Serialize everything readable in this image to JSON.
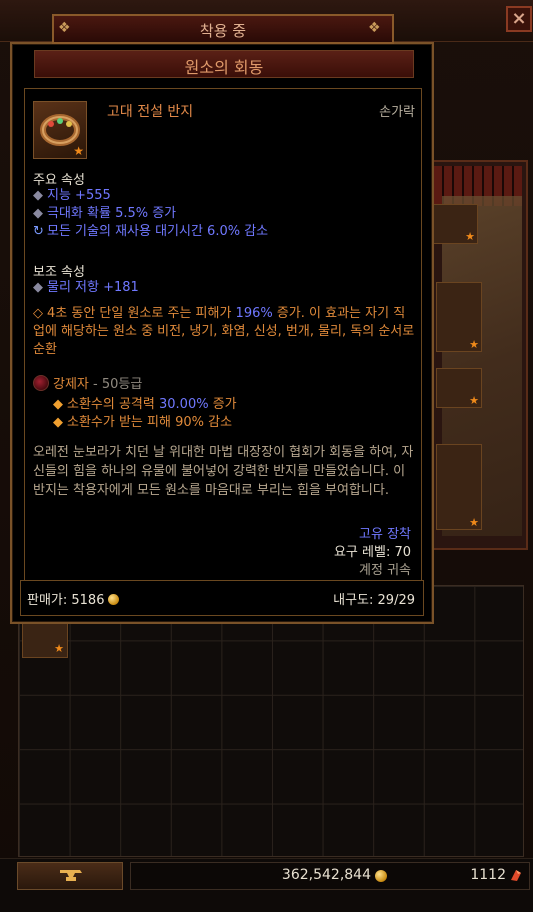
{
  "window": {
    "close_label": "×"
  },
  "tooltip": {
    "header": "착용 중",
    "item_name": "원소의 회동",
    "item_type": "고대 전설 반지",
    "slot": "손가락",
    "primary": {
      "title": "주요 속성",
      "affixes": [
        "지능 +555",
        "극대화 확률 5.5% 증가",
        "모든 기술의 재사용 대기시간 6.0% 감소"
      ]
    },
    "secondary": {
      "title": "보조 속성",
      "affixes": [
        "물리 저항 +181"
      ],
      "legendary_prefix": "4초 동안 단일 원소로 주는 피해가 ",
      "legendary_value": "196%",
      "legendary_suffix": " 증가. 이 효과는 자기 직업에 해당하는 원소 중 비전, 냉기, 화염, 신성, 번개, 물리, 독의 순서로 순환"
    },
    "gem": {
      "name": "강제자",
      "rank": " - 50등급",
      "effects": [
        {
          "prefix": "소환수의 공격력 ",
          "value": "30.00%",
          "suffix": " 증가"
        },
        {
          "prefix": "소환수가 받는 피해 90% 감소",
          "value": "",
          "suffix": ""
        }
      ]
    },
    "flavor": "오레전 눈보라가 치던 날 위대한 마법 대장장이 협회가 회동을 하여, 자신들의 힘을 하나의 유물에 불어넣어 강력한 반지를 만들었습니다. 이 반지는 착용자에게 모든 원소를 마음대로 부리는 힘을 부여합니다.",
    "unique_equipped": "고유 장착",
    "required_level": "요구 레벨: 70",
    "account_bound": "계정 귀속",
    "sell_price": "판매가: 5186",
    "durability": "내구도: 29/29"
  },
  "bottom_bar": {
    "gold": "362,542,844",
    "shards": "1112"
  },
  "colors": {
    "legendary_orange": "#e08a3a",
    "magic_blue": "#7078ff",
    "frame_bronze": "#7a5228"
  },
  "icons": [
    "close-icon",
    "ring-icon",
    "gem-icon",
    "gold-coin-icon",
    "blood-shard-icon",
    "anvil-icon"
  ]
}
